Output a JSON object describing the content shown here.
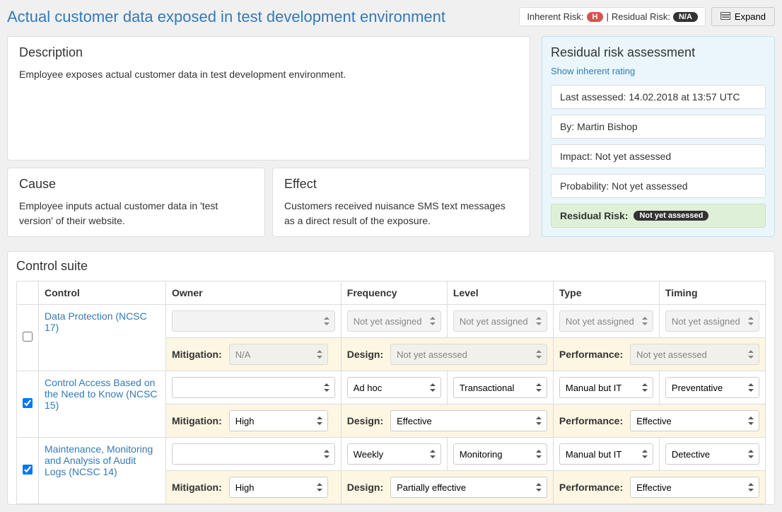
{
  "header": {
    "title": "Actual customer data exposed in test development environment",
    "inherent_label": "Inherent Risk:",
    "inherent_value": "H",
    "separator": "|",
    "residual_label": "Residual Risk:",
    "residual_value": "N/A",
    "expand": "Expand"
  },
  "description": {
    "heading": "Description",
    "body": "Employee exposes actual customer data in test development environment."
  },
  "cause": {
    "heading": "Cause",
    "body": "Employee inputs actual customer data in 'test version' of their website."
  },
  "effect": {
    "heading": "Effect",
    "body": "Customers received nuisance SMS text messages as a direct result of the exposure."
  },
  "assessment": {
    "heading": "Residual risk assessment",
    "show_link": "Show inherent rating",
    "last_assessed": "Last assessed: 14.02.2018 at 13:57 UTC",
    "by": "By: Martin Bishop",
    "impact": "Impact: Not yet assessed",
    "probability": "Probability: Not yet assessed",
    "residual_label": "Residual Risk:",
    "residual_value": "Not yet assessed"
  },
  "suite": {
    "heading": "Control suite",
    "headers": {
      "control": "Control",
      "owner": "Owner",
      "frequency": "Frequency",
      "level": "Level",
      "type": "Type",
      "timing": "Timing"
    },
    "sub_labels": {
      "mitigation": "Mitigation:",
      "design": "Design:",
      "performance": "Performance:"
    },
    "rows": [
      {
        "checked": false,
        "control": "Data Protection (NCSC 17)",
        "owner_disabled": true,
        "owner": "",
        "frequency": "Not yet assigned",
        "frequency_disabled": true,
        "level": "Not yet assigned",
        "level_disabled": true,
        "type": "Not yet assigned",
        "type_disabled": true,
        "timing": "Not yet assigned",
        "timing_disabled": true,
        "mitigation": "N/A",
        "mitigation_disabled": true,
        "design": "Not yet assessed",
        "design_disabled": true,
        "performance": "Not yet assessed",
        "performance_disabled": true
      },
      {
        "checked": true,
        "control": "Control Access Based on the Need to Know (NCSC 15)",
        "owner_disabled": false,
        "owner": "",
        "frequency": "Ad hoc",
        "frequency_disabled": false,
        "level": "Transactional",
        "level_disabled": false,
        "type": "Manual but IT",
        "type_disabled": false,
        "timing": "Preventative",
        "timing_disabled": false,
        "mitigation": "High",
        "mitigation_disabled": false,
        "design": "Effective",
        "design_disabled": false,
        "performance": "Effective",
        "performance_disabled": false
      },
      {
        "checked": true,
        "control": "Maintenance, Monitoring and Analysis of Audit Logs (NCSC 14)",
        "owner_disabled": false,
        "owner": "",
        "frequency": "Weekly",
        "frequency_disabled": false,
        "level": "Monitoring",
        "level_disabled": false,
        "type": "Manual but IT",
        "type_disabled": false,
        "timing": "Detective",
        "timing_disabled": false,
        "mitigation": "High",
        "mitigation_disabled": false,
        "design": "Partially effective",
        "design_disabled": false,
        "performance": "Effective",
        "performance_disabled": false
      }
    ]
  }
}
